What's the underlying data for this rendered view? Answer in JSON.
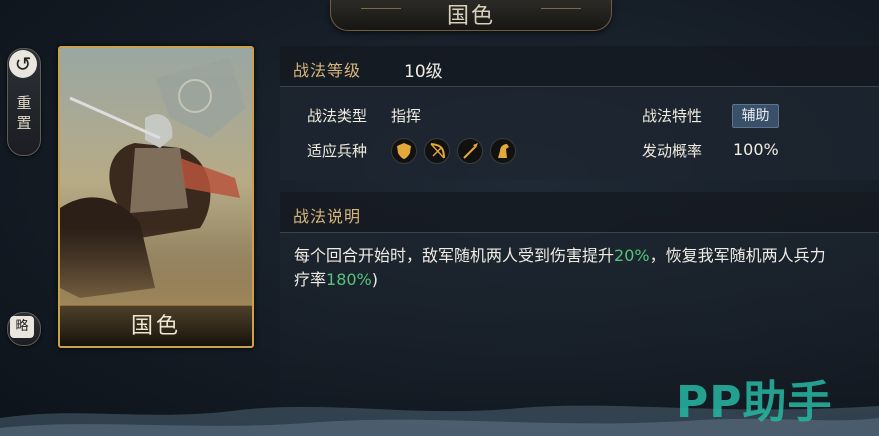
{
  "window": {
    "title": "国色"
  },
  "side": {
    "reset_label": "重\n置",
    "brief_label": "略"
  },
  "card": {
    "name": "国色"
  },
  "level": {
    "label": "战法等级",
    "value": "10级"
  },
  "attributes": {
    "type_label": "战法类型",
    "type_value": "指挥",
    "troops_label": "适应兵种",
    "troop_icons": [
      "shield-icon",
      "bow-icon",
      "spear-icon",
      "horse-icon"
    ],
    "trait_label": "战法特性",
    "trait_value": "辅助",
    "rate_label": "发动概率",
    "rate_value": "100%"
  },
  "description": {
    "label": "战法说明",
    "line1_pre": "每个回合开始时，敌军随机两人受到伤害提升",
    "line1_num": "20%",
    "line1_post": "，恢复我军随机两人兵力",
    "line2_pre": "疗率",
    "line2_num": "180%",
    "line2_post": ")"
  },
  "watermark": "PP助手",
  "colors": {
    "gold": "#d7b57b",
    "green": "#55c37a",
    "card_border": "#c9a24a",
    "badge": "#3a4f68"
  }
}
